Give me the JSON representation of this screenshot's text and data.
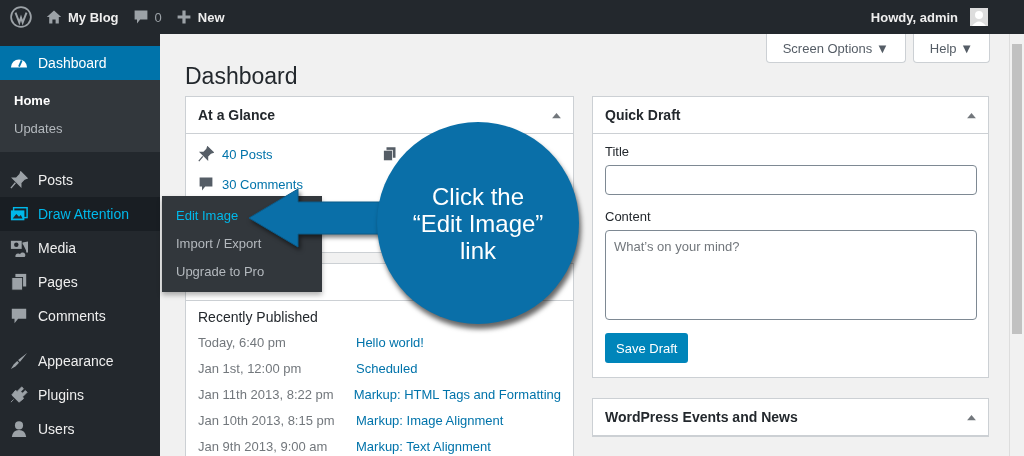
{
  "toolbar": {
    "site": "My Blog",
    "comments": "0",
    "new": "New",
    "account": "Howdy, admin"
  },
  "sidebar": {
    "groups": [
      [
        {
          "label": "Dashboard",
          "selected": true,
          "open": false,
          "children": [
            {
              "label": "Home",
              "selected": true
            },
            {
              "label": "Updates",
              "selected": false
            }
          ]
        }
      ],
      [
        {
          "label": "Posts",
          "selected": false,
          "open": false
        },
        {
          "label": "Draw Attention",
          "selected": false,
          "open": true,
          "flyout": [
            {
              "label": "Edit Image",
              "selected": true
            },
            {
              "label": "Import / Export",
              "selected": false
            },
            {
              "label": "Upgrade to Pro",
              "selected": false
            }
          ]
        },
        {
          "label": "Media",
          "selected": false,
          "open": false
        },
        {
          "label": "Pages",
          "selected": false,
          "open": false
        },
        {
          "label": "Comments",
          "selected": false,
          "open": false
        }
      ],
      [
        {
          "label": "Appearance",
          "selected": false,
          "open": false
        },
        {
          "label": "Plugins",
          "selected": false,
          "open": false
        },
        {
          "label": "Users",
          "selected": false,
          "open": false
        }
      ]
    ]
  },
  "page": {
    "title": "Dashboard",
    "buttons": [
      "Screen Options ▼",
      "Help ▼"
    ]
  },
  "at_a_glance": {
    "title": "At a Glance",
    "items": [
      "40 Posts",
      "30 Comments"
    ]
  },
  "activity": {
    "heading": "Recently Published",
    "rows": [
      {
        "date": "Today, 6:40 pm",
        "title": "Hello world!"
      },
      {
        "date": "Jan 1st, 12:00 pm",
        "title": "Scheduled"
      },
      {
        "date": "Jan 11th 2013, 8:22 pm",
        "title": "Markup: HTML Tags and Formatting"
      },
      {
        "date": "Jan 10th 2013, 8:15 pm",
        "title": "Markup: Image Alignment"
      },
      {
        "date": "Jan 9th 2013, 9:00 am",
        "title": "Markup: Text Alignment"
      }
    ]
  },
  "quick_draft": {
    "title": "Quick Draft",
    "title_label": "Title",
    "content_label": "Content",
    "placeholder": "What’s on your mind?",
    "button": "Save Draft"
  },
  "events": {
    "title": "WordPress Events and News"
  },
  "callout": {
    "lines": [
      "Click the",
      "“Edit Image”",
      "link"
    ]
  }
}
